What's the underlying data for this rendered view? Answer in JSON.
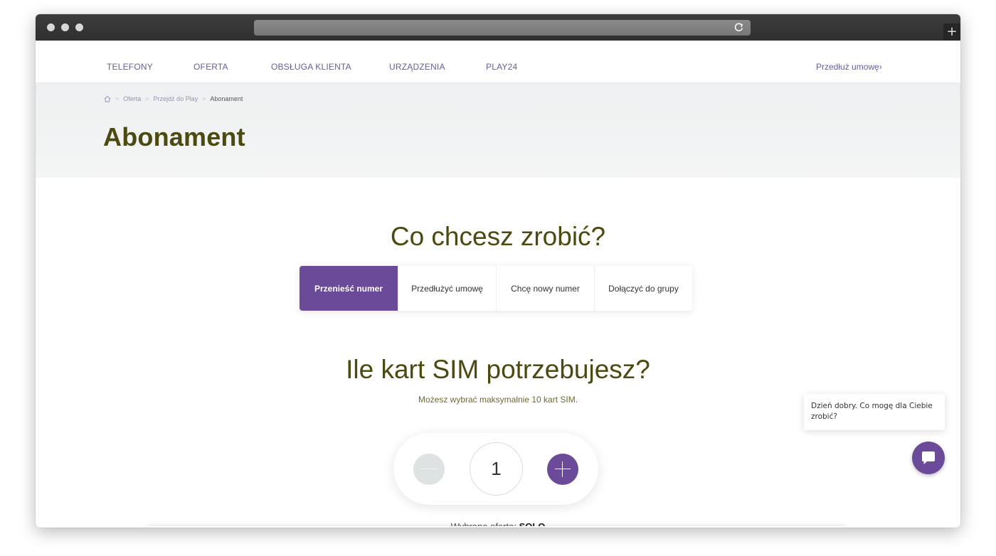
{
  "nav": {
    "items": [
      "TELEFONY",
      "OFERTA",
      "OBSŁUGA KLIENTA",
      "URZĄDZENIA",
      "PLAY24"
    ],
    "extend_label": "Przedłuż umowę›"
  },
  "breadcrumb": {
    "items": [
      "Oferta",
      "Przejdź do Play",
      "Abonament"
    ],
    "separator": ">"
  },
  "page": {
    "title": "Abonament"
  },
  "question1": {
    "title": "Co chcesz zrobić?",
    "options": [
      "Przenieść numer",
      "Przedłużyć umowę",
      "Chcę nowy numer",
      "Dołączyć do grupy"
    ],
    "selected": "Przenieść numer"
  },
  "question2": {
    "title": "Ile kart SIM potrzebujesz?",
    "subtitle": "Możesz wybrać maksymalnie 10 kart SIM.",
    "count": "1"
  },
  "offer": {
    "label": "Wybrana oferta:",
    "value": "SOLO"
  },
  "chat": {
    "message": "Dzień dobry. Co mogę dla Ciebie zrobić?"
  },
  "colors": {
    "accent": "#6b4a9a",
    "heading": "#4c4a10"
  }
}
